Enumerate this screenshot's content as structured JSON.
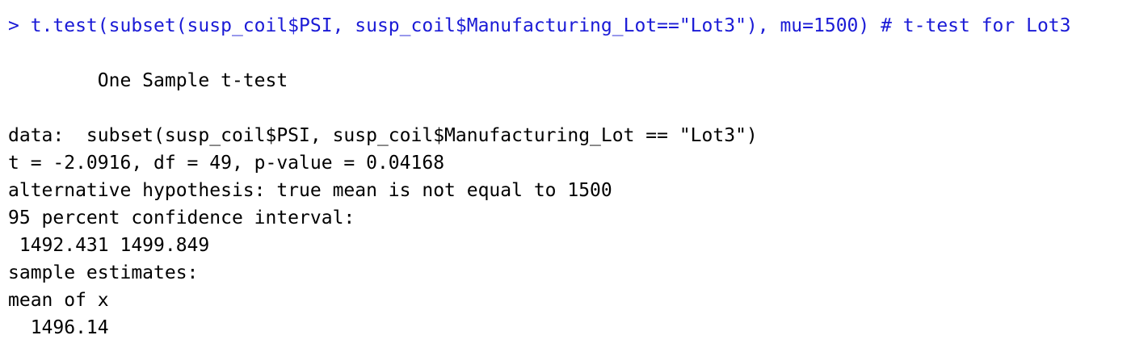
{
  "console": {
    "command": "> t.test(subset(susp_coil$PSI, susp_coil$Manufacturing_Lot==\"Lot3\"), mu=1500) # t-test for Lot3",
    "command_color": "#1a1ad6",
    "output": {
      "title": "        One Sample t-test",
      "data_line": "data:  subset(susp_coil$PSI, susp_coil$Manufacturing_Lot == \"Lot3\")",
      "stats_line": "t = -2.0916, df = 49, p-value = 0.04168",
      "alternative_line": "alternative hypothesis: true mean is not equal to 1500",
      "ci_label": "95 percent confidence interval:",
      "ci_values": " 1492.431 1499.849",
      "estimates_label": "sample estimates:",
      "estimate_name": "mean of x",
      "estimate_value": "  1496.14"
    }
  }
}
